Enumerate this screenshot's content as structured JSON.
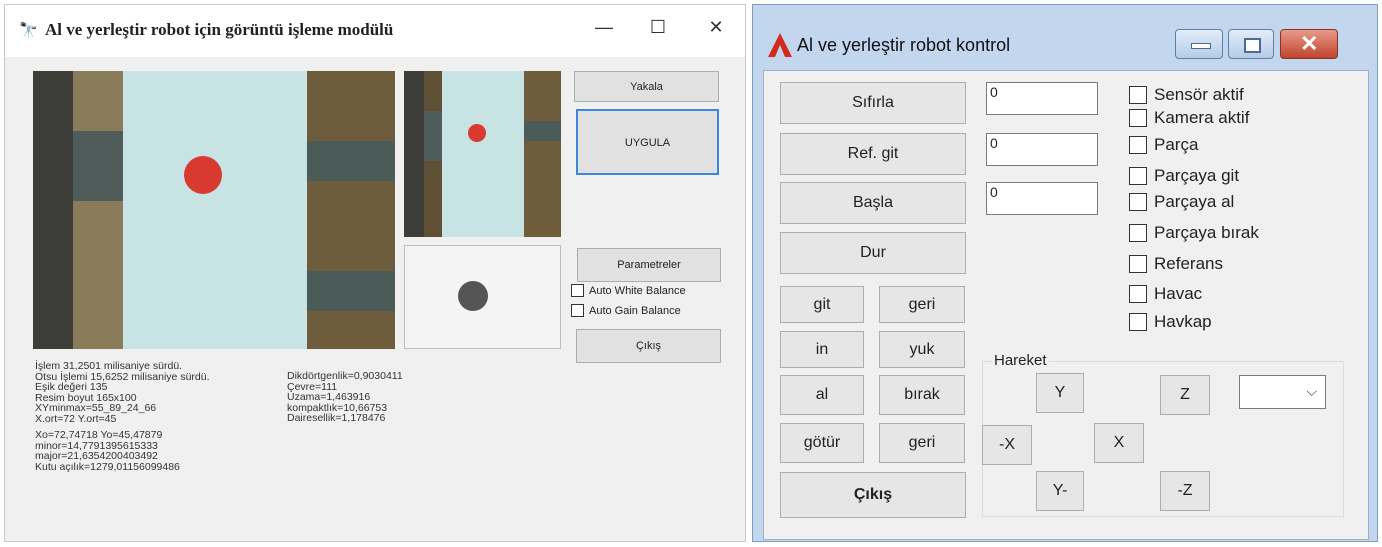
{
  "left_window": {
    "title": "Al ve yerleştir robot için görüntü işleme modülü",
    "controls": {
      "minimize": "—",
      "maximize": "☐",
      "close": "✕"
    },
    "buttons": {
      "capture": "Yakala",
      "apply": "UYGULA",
      "parameters": "Parametreler",
      "exit": "Çıkış"
    },
    "checkboxes": [
      {
        "label": "Auto White Balance",
        "checked": false
      },
      {
        "label": "Auto Gain Balance",
        "checked": false
      }
    ],
    "stats_left": [
      "İşlem 31,2501 milisaniye sürdü.",
      "Otsu İşlemi 15,6252 milisaniye sürdü.",
      "Eşik değeri 135",
      "Resim boyut 165x100",
      "XYminmax=55_89_24_66",
      "X.ort=72  Y.ort=45",
      "",
      "Xo=72,74718  Yo=45,47879",
      "minor=14,7791395615333",
      "major=21,6354200403492",
      "Kutu açılık=1279,01156099486"
    ],
    "stats_right": [
      "Dikdörtgenlik=0,9030411",
      "Çevre=111",
      "Uzama=1,463916",
      "kompaktlık=10,66753",
      "Dairesellik=1,178476"
    ]
  },
  "right_window": {
    "title": "Al ve yerleştir robot kontrol",
    "buttons": {
      "reset": "Sıfırla",
      "ref_go": "Ref. git",
      "start": "Başla",
      "stop": "Dur",
      "go": "git",
      "back1": "geri",
      "down": "in",
      "up": "yuk",
      "take": "al",
      "drop": "bırak",
      "carry": "götür",
      "back2": "geri",
      "exit": "Çıkış"
    },
    "inputs": [
      "0",
      "0",
      "0"
    ],
    "checkboxes": [
      {
        "label": "Sensör aktif",
        "checked": false
      },
      {
        "label": "Kamera aktif",
        "checked": false
      },
      {
        "label": "Parça",
        "checked": false
      },
      {
        "label": "Parçaya git",
        "checked": false
      },
      {
        "label": "Parçaya al",
        "checked": false
      },
      {
        "label": "Parçaya bırak",
        "checked": false
      },
      {
        "label": "Referans",
        "checked": false
      },
      {
        "label": "Havac",
        "checked": false
      },
      {
        "label": "Havkap",
        "checked": false
      }
    ],
    "movement": {
      "label": "Hareket",
      "y_plus": "Y",
      "z_plus": "Z",
      "x_minus": "-X",
      "x_plus": "X",
      "y_minus": "Y-",
      "z_minus": "-Z",
      "combo_value": ""
    }
  }
}
